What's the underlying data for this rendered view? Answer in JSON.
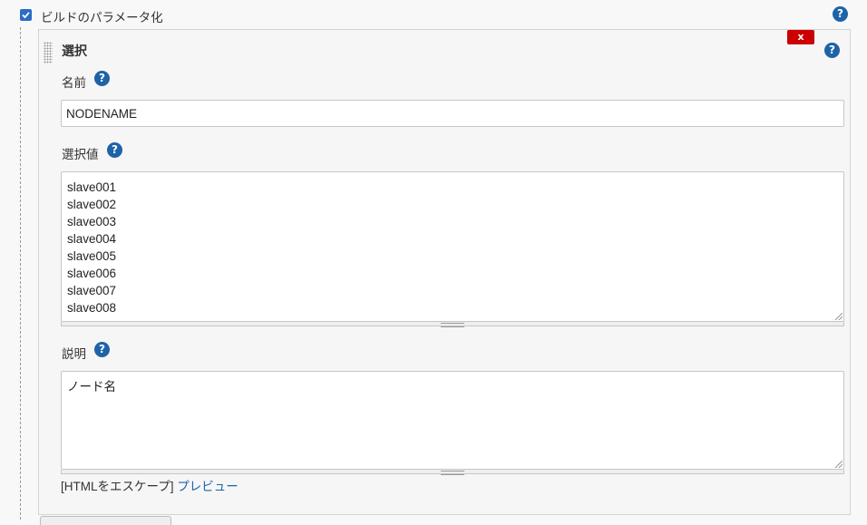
{
  "param_section": {
    "checkbox_checked": true,
    "checkbox_label": "ビルドのパラメータ化",
    "help_icon": "question-mark"
  },
  "choice_param": {
    "title": "選択",
    "delete_label": "x",
    "name": {
      "label": "名前",
      "value": "NODENAME"
    },
    "choices": {
      "label": "選択値",
      "value": "slave001\nslave002\nslave003\nslave004\nslave005\nslave006\nslave007\nslave008"
    },
    "description": {
      "label": "説明",
      "value": "ノード名"
    },
    "escape_text": "[HTMLをエスケープ]",
    "preview_link": "プレビュー"
  },
  "colors": {
    "help_icon": "#1d63a8",
    "checkbox": "#2b6cc4",
    "delete_button": "#cc0000",
    "link": "#1d63a8"
  }
}
